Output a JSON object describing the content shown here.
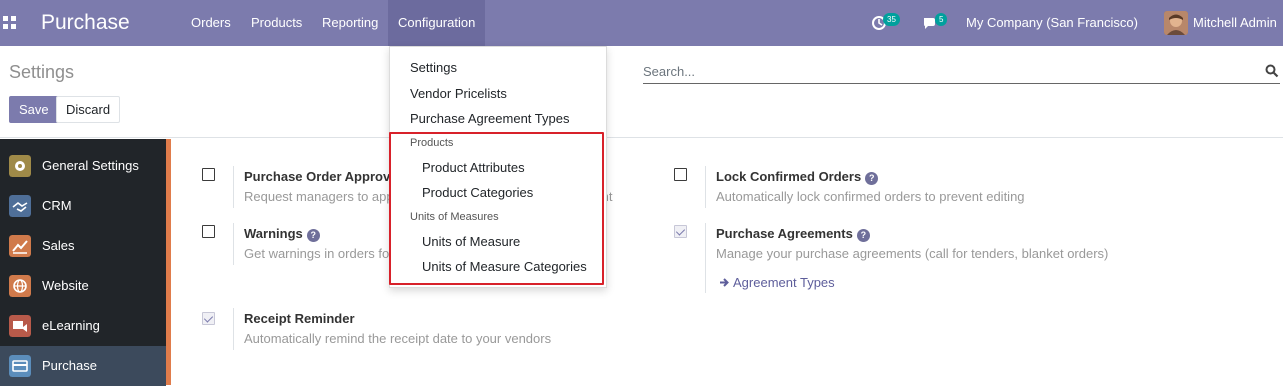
{
  "navbar": {
    "brand": "Purchase",
    "menu": [
      "Orders",
      "Products",
      "Reporting",
      "Configuration"
    ],
    "activity_count": "35",
    "message_count": "5",
    "company": "My Company (San Francisco)",
    "user": "Mitchell Admin"
  },
  "control_panel": {
    "title": "Settings",
    "save_label": "Save",
    "discard_label": "Discard",
    "search_placeholder": "Search..."
  },
  "sidebar": {
    "items": [
      {
        "label": "General Settings",
        "icon": "gear-icon",
        "color": "#9f8a48"
      },
      {
        "label": "CRM",
        "icon": "handshake-icon",
        "color": "#4f6f98"
      },
      {
        "label": "Sales",
        "icon": "chart-icon",
        "color": "#d07a4b"
      },
      {
        "label": "Website",
        "icon": "globe-icon",
        "color": "#d07a4b"
      },
      {
        "label": "eLearning",
        "icon": "elearning-icon",
        "color": "#b85a4a"
      },
      {
        "label": "Purchase",
        "icon": "card-icon",
        "color": "#5b8dbb"
      }
    ]
  },
  "settings": {
    "po_approval": {
      "title": "Purchase Order Approval",
      "desc": "Request managers to approve orders above a minimum amount"
    },
    "warnings": {
      "title": "Warnings",
      "desc": "Get warnings in orders for products or vendors"
    },
    "receipt_reminder": {
      "title": "Receipt Reminder",
      "desc": "Automatically remind the receipt date to your vendors"
    },
    "lock_orders": {
      "title": "Lock Confirmed Orders",
      "desc": "Automatically lock confirmed orders to prevent editing"
    },
    "agreements": {
      "title": "Purchase Agreements",
      "desc": "Manage your purchase agreements (call for tenders, blanket orders)",
      "link": "Agreement Types"
    }
  },
  "dropdown": {
    "items": [
      "Settings",
      "Vendor Pricelists",
      "Purchase Agreement Types"
    ],
    "products_header": "Products",
    "products_items": [
      "Product Attributes",
      "Product Categories"
    ],
    "uom_header": "Units of Measures",
    "uom_items": [
      "Units of Measure",
      "Units of Measure Categories"
    ]
  },
  "colors": {
    "navbar": "#7c7bad",
    "sidebar": "#212529",
    "accent": "#e07c4b",
    "highlight": "#d8212a"
  }
}
